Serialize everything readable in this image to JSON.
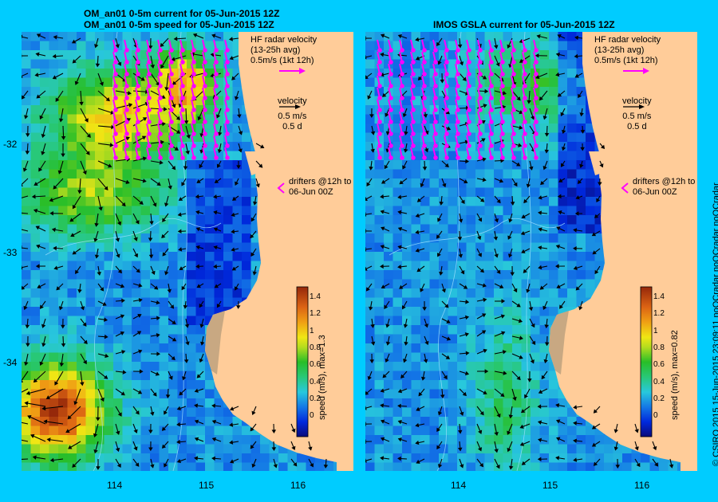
{
  "left_panel": {
    "title_line1": "OM_an01 0-5m current for 05-Jun-2015 12Z",
    "title_line2": "OM_an01 0-5m speed for 05-Jun-2015 12Z",
    "colorbar_label": "speed (m/s), max=1.3"
  },
  "right_panel": {
    "title": "IMOS GSLA current for 05-Jun-2015 12Z",
    "colorbar_label": "speed (m/s), max=0.82"
  },
  "legend": {
    "hf_line1": "HF radar velocity",
    "hf_line2": "(13-25h avg)",
    "hf_line3": "0.5m/s (1kt 12h)",
    "velocity_title": "velocity",
    "velocity_speed": "0.5 m/s",
    "velocity_days": "0.5 d",
    "drifters_line1": "drifters @12h to",
    "drifters_line2": "06-Jun 00Z"
  },
  "axes": {
    "x_ticks": [
      "114",
      "115",
      "116"
    ],
    "y_ticks": [
      "-32",
      "-33",
      "-34"
    ]
  },
  "colorbar_ticks": [
    "1.4",
    "1.2",
    "1",
    "0.8",
    "0.6",
    "0.4",
    "0.2",
    "0"
  ],
  "credit": "© CSIRO 2015   15-Jun-2015 23:09:11 noQCradar noQCradar noQCradar",
  "colors": {
    "background": "#00ccff",
    "land": "#ffcc99",
    "hf_arrow": "#ff00ff"
  }
}
